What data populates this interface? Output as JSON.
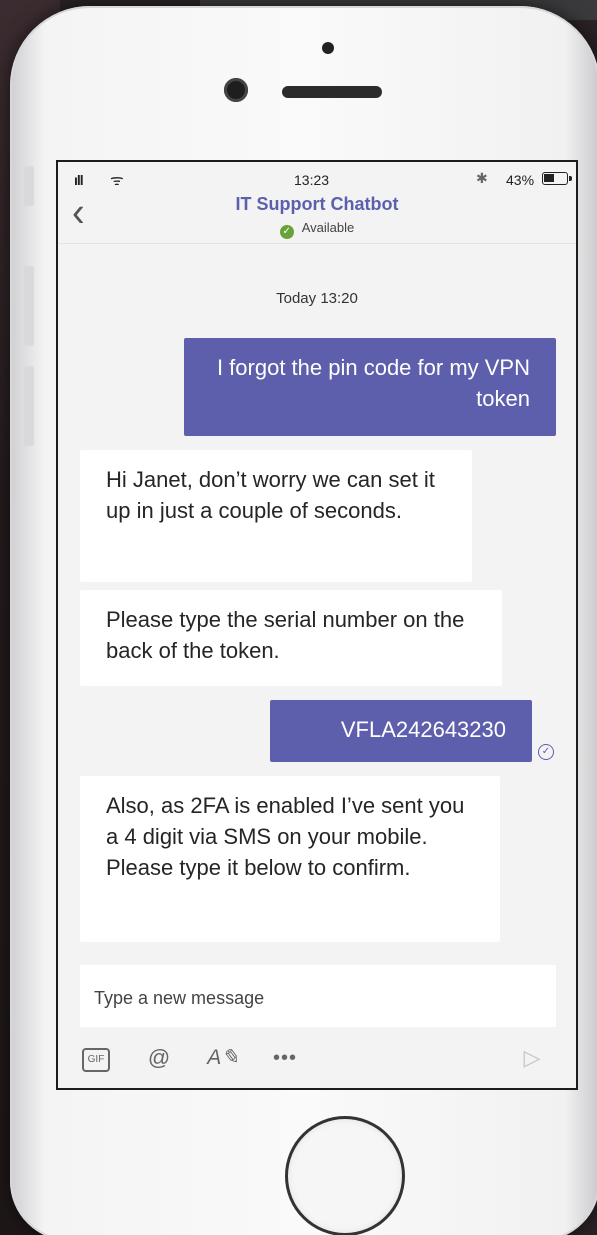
{
  "status_bar": {
    "signal": "ıll",
    "wifi": "ᯤ",
    "time": "13:23",
    "bluetooth": "✱",
    "battery": "43%"
  },
  "header": {
    "back": "‹",
    "title": "IT Support Chatbot",
    "presence_icon": "✓",
    "presence": "Available"
  },
  "conversation": {
    "timestamp": "Today 13:20",
    "messages": [
      {
        "from": "user",
        "text": "I forgot the pin code for my VPN token"
      },
      {
        "from": "bot",
        "text": "Hi Janet, don’t worry we can set it up in just a couple of seconds."
      },
      {
        "from": "bot",
        "text": "Please type the serial number on the back of the token."
      },
      {
        "from": "user",
        "text": "VFLA242643230"
      },
      {
        "from": "bot",
        "text": "Also, as 2FA is enabled I’ve sent you a 4 digit via SMS on your mobile. Please type it below to confirm."
      }
    ],
    "read_receipt": "✓"
  },
  "compose": {
    "placeholder": "Type a new message"
  },
  "toolbar": {
    "gif": "GIF",
    "mention": "@",
    "format": "A✎",
    "more": "•••",
    "send": "▷"
  },
  "colors": {
    "accent": "#5d5fac",
    "presence": "#6aa23a"
  }
}
